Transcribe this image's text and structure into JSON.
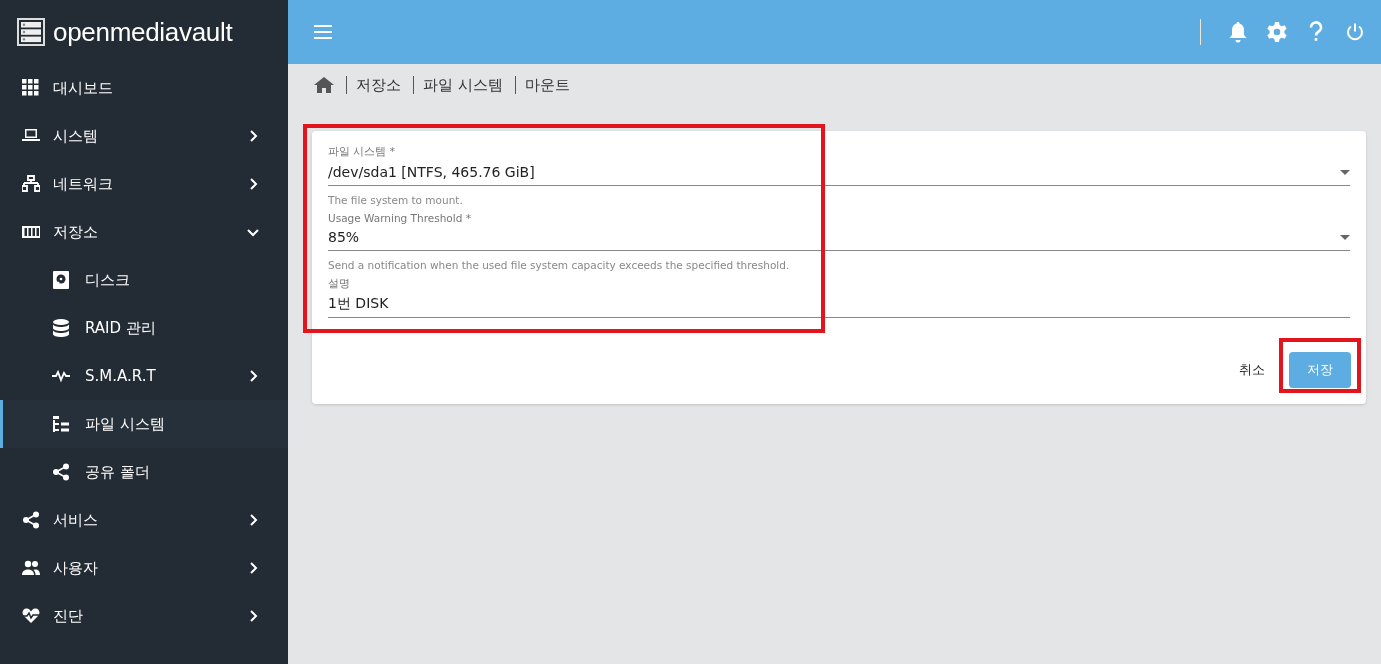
{
  "brand": {
    "name": "openmediavault"
  },
  "sidebar": {
    "items": [
      {
        "label": "대시보드",
        "selected": false
      },
      {
        "label": "시스템",
        "selected": false,
        "expanded": false
      },
      {
        "label": "네트워크",
        "selected": false,
        "expanded": false
      },
      {
        "label": "저장소",
        "selected": false,
        "expanded": true,
        "children": [
          {
            "label": "디스크",
            "selected": false
          },
          {
            "label": "RAID 관리",
            "selected": false
          },
          {
            "label": "S.M.A.R.T",
            "selected": false,
            "expanded": false
          },
          {
            "label": "파일 시스템",
            "selected": true
          },
          {
            "label": "공유 폴더",
            "selected": false
          }
        ]
      },
      {
        "label": "서비스",
        "selected": false,
        "expanded": false
      },
      {
        "label": "사용자",
        "selected": false,
        "expanded": false
      },
      {
        "label": "진단",
        "selected": false,
        "expanded": false
      }
    ]
  },
  "breadcrumb": [
    "저장소",
    "파일 시스템",
    "마운트"
  ],
  "form": {
    "fields": [
      {
        "kind": "select",
        "label": "파일 시스템 *",
        "value": "/dev/sda1 [NTFS, 465.76 GiB]",
        "hint": "The file system to mount."
      },
      {
        "kind": "select",
        "label": "Usage Warning Threshold *",
        "value": "85%",
        "hint": "Send a notification when the used file system capacity exceeds the specified threshold."
      },
      {
        "kind": "text",
        "label": "설명",
        "value": "1번 DISK"
      }
    ],
    "buttons": [
      {
        "kind": "flat",
        "label": "취소"
      },
      {
        "kind": "raised",
        "label": "저장"
      }
    ]
  }
}
